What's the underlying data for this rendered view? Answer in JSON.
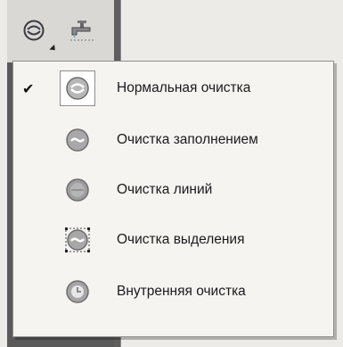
{
  "toolbar": {
    "tools": [
      {
        "icon": "eraser-tool-icon",
        "has_flyout": true
      },
      {
        "icon": "faucet-tool-icon",
        "has_flyout": false
      }
    ]
  },
  "menu": {
    "items": [
      {
        "label": "Нормальная очистка",
        "icon": "normal-erase-icon",
        "checked": true,
        "check_mark": "✔"
      },
      {
        "label": "Очистка заполнением",
        "icon": "erase-fills-icon",
        "checked": false,
        "check_mark": ""
      },
      {
        "label": "Очистка линий",
        "icon": "erase-lines-icon",
        "checked": false,
        "check_mark": ""
      },
      {
        "label": "Очистка выделения",
        "icon": "erase-selected-fills-icon",
        "checked": false,
        "check_mark": ""
      },
      {
        "label": "Внутренняя очистка",
        "icon": "erase-inside-icon",
        "checked": false,
        "check_mark": ""
      }
    ]
  },
  "colors": {
    "panel_dark": "#5a5a5a",
    "menu_bg": "#f5f4f1",
    "icon_grey": "#9a9a9a"
  }
}
